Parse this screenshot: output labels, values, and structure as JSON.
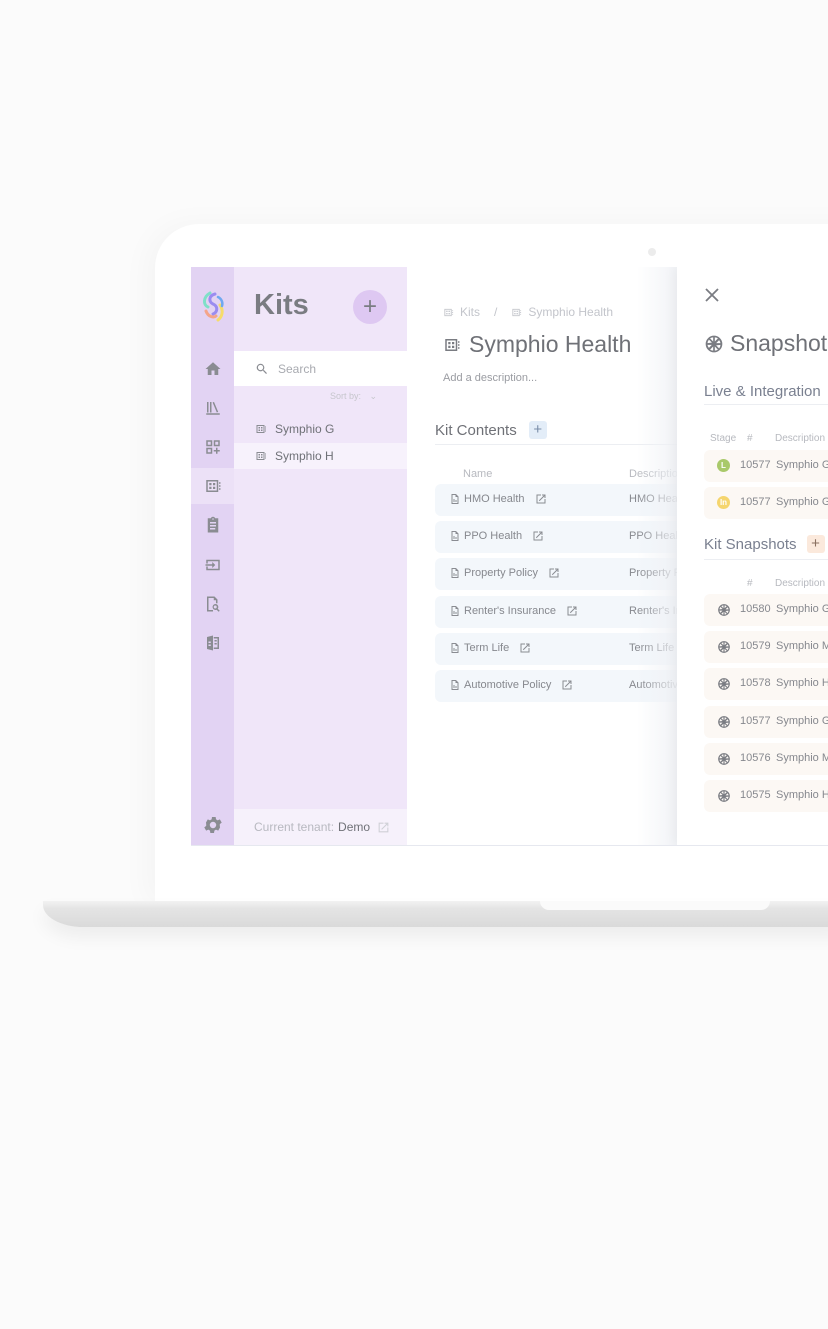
{
  "sidebar": {
    "logo": "symphio-logo",
    "items": [
      {
        "icon": "home-icon"
      },
      {
        "icon": "library-icon"
      },
      {
        "icon": "add-widget-icon"
      },
      {
        "icon": "kit-icon",
        "active": true
      },
      {
        "icon": "clipboard-icon"
      },
      {
        "icon": "input-icon"
      },
      {
        "icon": "document-search-icon"
      },
      {
        "icon": "book-compare-icon"
      }
    ],
    "settings_icon": "gear-icon"
  },
  "kits_panel": {
    "title": "Kits",
    "add_label": "+",
    "search_placeholder": "Search",
    "sort_label": "Sort by:",
    "items": [
      {
        "label": "Symphio G",
        "selected": false
      },
      {
        "label": "Symphio H",
        "selected": true
      }
    ],
    "tenant_label": "Current tenant:",
    "tenant_value": "Demo"
  },
  "main": {
    "breadcrumb": [
      "Kits",
      "Symphio Health"
    ],
    "breadcrumb_sep": "/",
    "title": "Symphio Health",
    "description_placeholder": "Add a description...",
    "section_title": "Kit Contents",
    "add_label": "+",
    "columns": [
      "Name",
      "Description"
    ],
    "rows": [
      {
        "name": "HMO Health",
        "description": "HMO Health"
      },
      {
        "name": "PPO Health",
        "description": "PPO Health"
      },
      {
        "name": "Property Policy",
        "description": "Property Policy"
      },
      {
        "name": "Renter's Insurance",
        "description": "Renter's Insurance"
      },
      {
        "name": "Term Life",
        "description": "Term Life"
      },
      {
        "name": "Automotive Policy",
        "description": "Automotive Policy"
      }
    ]
  },
  "drawer": {
    "title": "Snapshots",
    "live_section": "Live & Integration",
    "live_columns": [
      "Stage",
      "#",
      "Description"
    ],
    "live_rows": [
      {
        "stage": "L",
        "stage_color": "#a9c96a",
        "number": "10577",
        "description": "Symphio G"
      },
      {
        "stage": "In",
        "stage_color": "#f5d56e",
        "number": "10577",
        "description": "Symphio G"
      }
    ],
    "kit_section": "Kit Snapshots",
    "add_label": "+",
    "kit_columns": [
      "#",
      "Description"
    ],
    "kit_rows": [
      {
        "number": "10580",
        "description": "Symphio G"
      },
      {
        "number": "10579",
        "description": "Symphio M"
      },
      {
        "number": "10578",
        "description": "Symphio H"
      },
      {
        "number": "10577",
        "description": "Symphio G"
      },
      {
        "number": "10576",
        "description": "Symphio M"
      },
      {
        "number": "10575",
        "description": "Symphio H"
      }
    ]
  }
}
